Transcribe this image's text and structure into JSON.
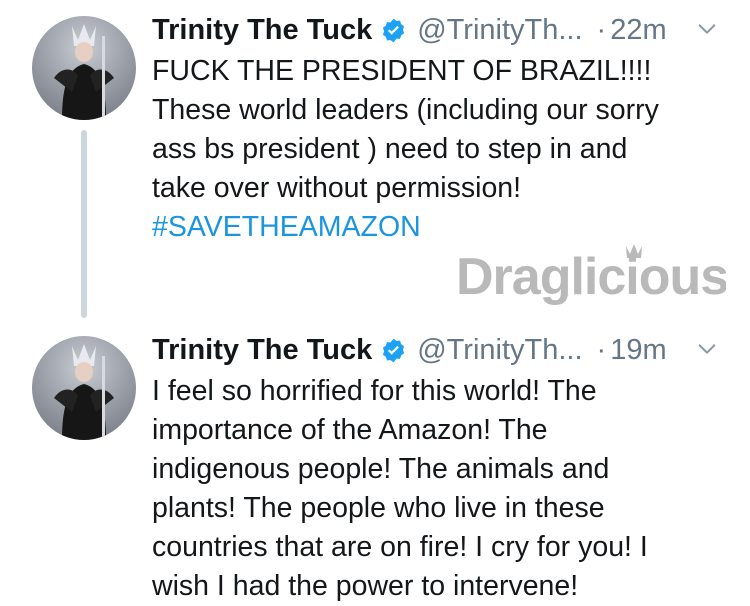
{
  "tweets": [
    {
      "display_name": "Trinity The Tuck",
      "handle": "@TrinityTh...",
      "separator": "·",
      "time": "22m",
      "lines": [
        "FUCK THE PRESIDENT OF BRAZIL!!!!",
        "These world leaders (including our sorry",
        "ass bs president ) need to step in and",
        "take over without permission!"
      ],
      "hashtag": "#SAVETHEAMAZON"
    },
    {
      "display_name": "Trinity The Tuck",
      "handle": "@TrinityTh...",
      "separator": "·",
      "time": "19m",
      "lines": [
        "I feel so horrified for this world! The",
        "importance of the Amazon! The",
        "indigenous people! The animals and",
        "plants! The people who live in these",
        "countries that are on fire! I cry for you! I",
        "wish I had the power to intervene!"
      ]
    }
  ],
  "watermark": {
    "text": "Draglicious"
  },
  "colors": {
    "name": "#14171a",
    "muted": "#657786",
    "link": "#1b95e0",
    "verified": "#1da1f2",
    "thread_line": "#ccd6dd",
    "watermark": "#b9b9b9"
  },
  "icons": [
    "verified-badge-icon",
    "chevron-down-icon",
    "avatar-image"
  ]
}
